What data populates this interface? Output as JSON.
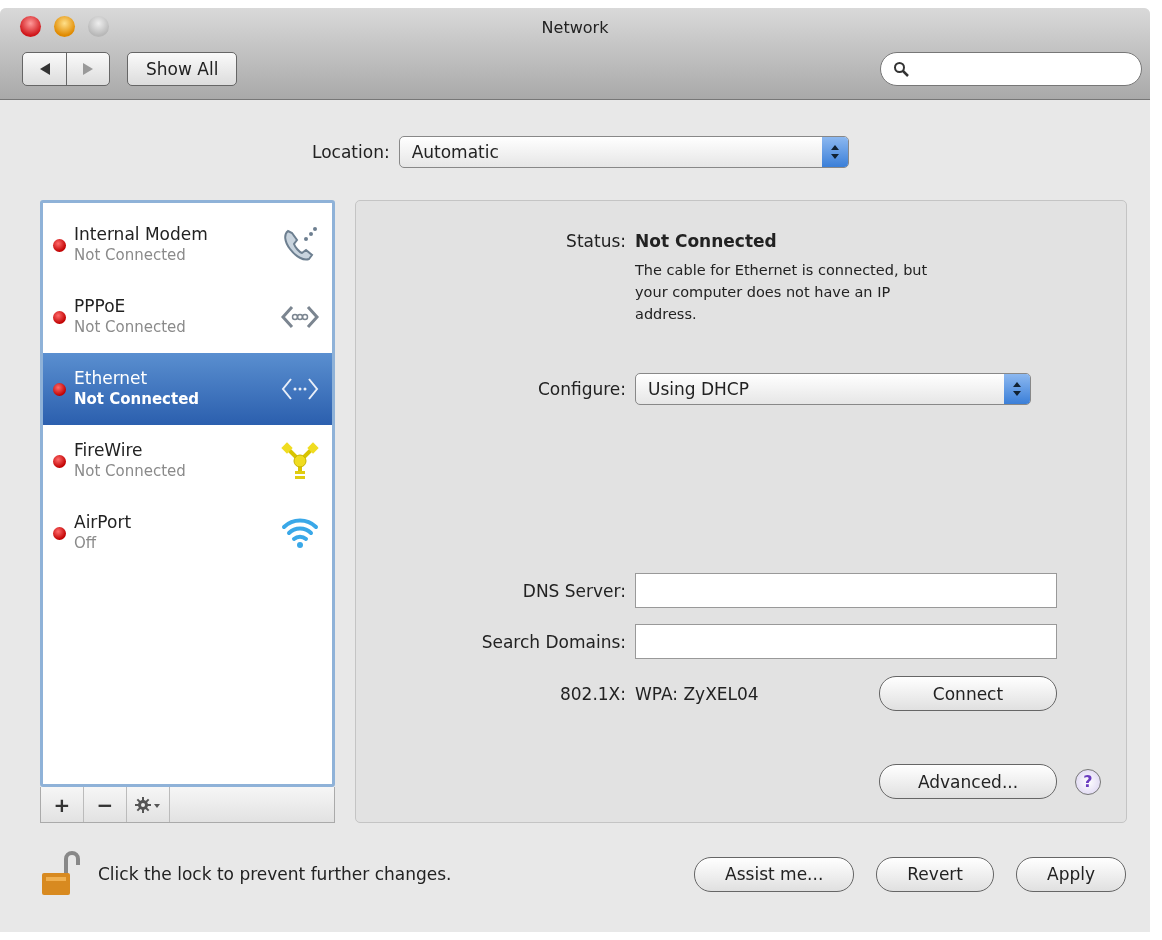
{
  "window": {
    "title": "Network"
  },
  "toolbar": {
    "show_all": "Show All"
  },
  "location": {
    "label": "Location:",
    "value": "Automatic"
  },
  "services": [
    {
      "name": "Internal Modem",
      "status": "Not Connected",
      "kind": "modem",
      "selected": false
    },
    {
      "name": "PPPoE",
      "status": "Not Connected",
      "kind": "pppoe",
      "selected": false
    },
    {
      "name": "Ethernet",
      "status": "Not Connected",
      "kind": "ethernet",
      "selected": true
    },
    {
      "name": "FireWire",
      "status": "Not Connected",
      "kind": "firewire",
      "selected": false
    },
    {
      "name": "AirPort",
      "status": "Off",
      "kind": "wifi",
      "selected": false
    }
  ],
  "list_buttons": {
    "add": "+",
    "remove": "−"
  },
  "detail": {
    "status_label": "Status:",
    "status_value": "Not Connected",
    "status_description": "The cable for Ethernet is connected, but your computer does not have an IP address.",
    "configure_label": "Configure:",
    "configure_value": "Using DHCP",
    "dns_label": "DNS Server:",
    "search_domains_label": "Search Domains:",
    "dot1x_label": "802.1X:",
    "dot1x_value": "WPA: ZyXEL04",
    "connect": "Connect",
    "advanced": "Advanced...",
    "help": "?"
  },
  "footer": {
    "lock_text": "Click the lock to prevent further changes.",
    "buttons": [
      "Assist me...",
      "Revert",
      "Apply"
    ]
  }
}
